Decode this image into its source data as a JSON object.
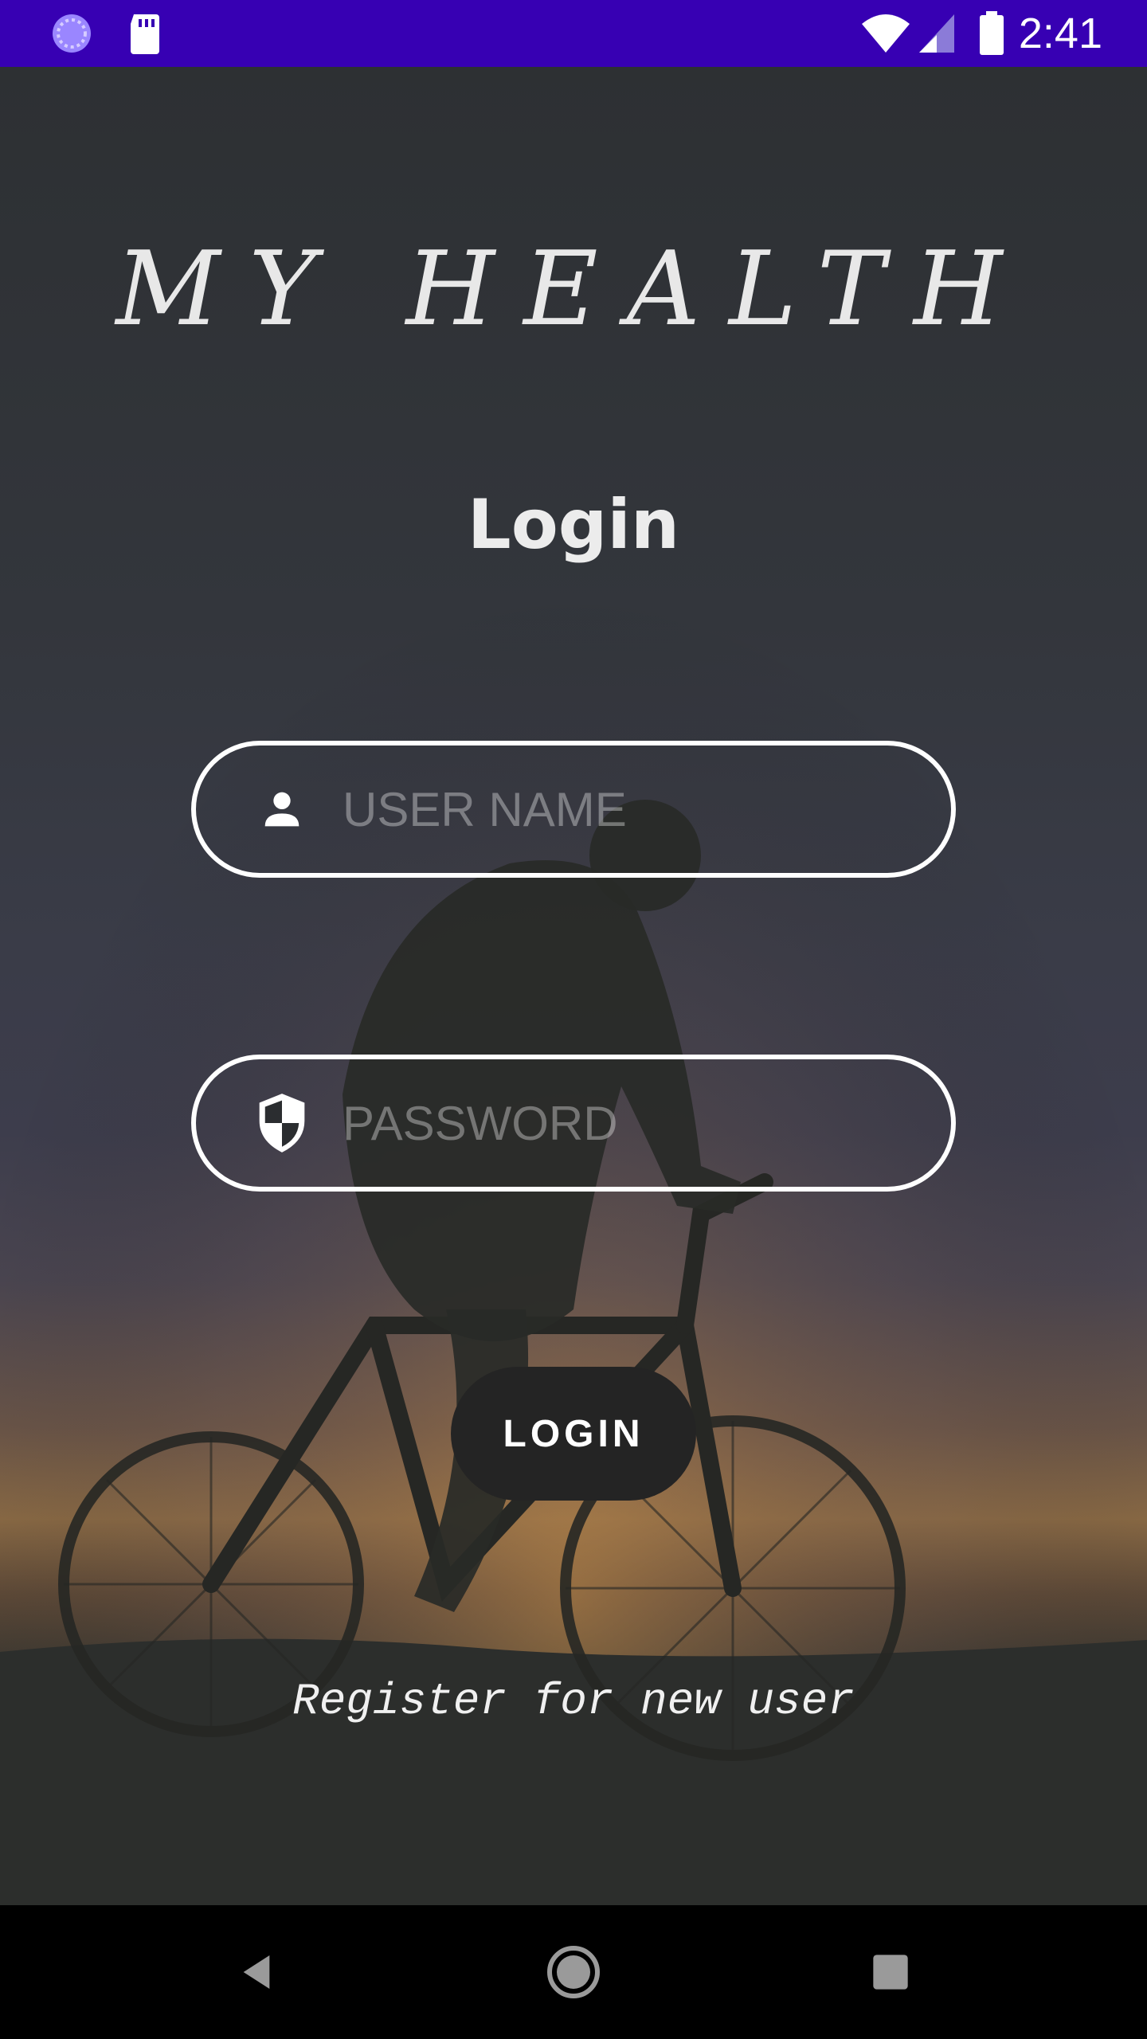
{
  "status_bar": {
    "time": "2:41",
    "icons": [
      "sync-icon",
      "sd-card-icon",
      "wifi-icon",
      "signal-icon",
      "battery-icon"
    ],
    "background": "#3700b3"
  },
  "app": {
    "title": "MY HEALTH",
    "heading": "Login",
    "username": {
      "placeholder": "USER NAME",
      "value": "",
      "icon": "person-icon"
    },
    "password": {
      "placeholder": "PASSWORD",
      "value": "",
      "icon": "shield-icon"
    },
    "login_button": "LOGIN",
    "register_link": "Register for new user",
    "background_image": "cyclist-silhouette-at-sunset"
  },
  "nav_bar": {
    "buttons": [
      "back-icon",
      "home-icon",
      "recents-icon"
    ]
  }
}
